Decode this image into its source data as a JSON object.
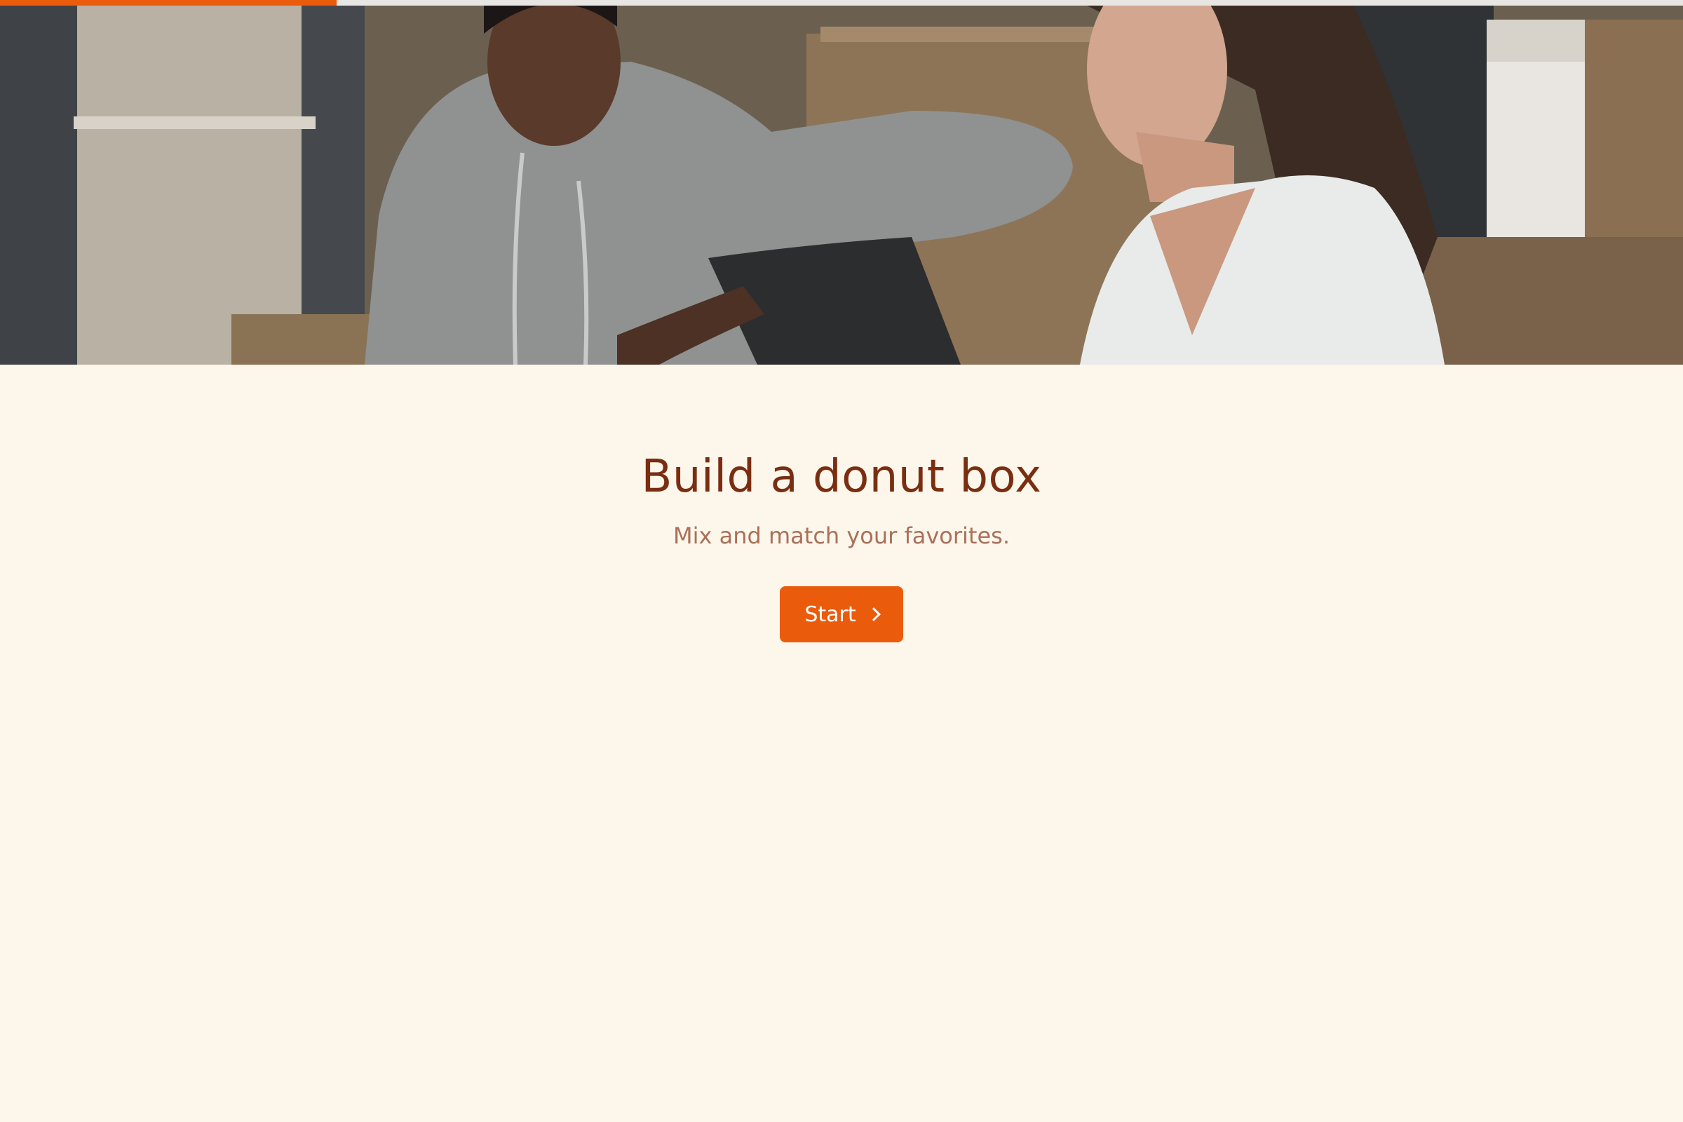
{
  "progress": {
    "fraction": 0.2,
    "fill_color": "#ea5b0c",
    "track_color": "#e8e6e3"
  },
  "hero": {
    "image_icon": "photo-couple-moving-boxes"
  },
  "main": {
    "title": "Build a donut box",
    "subtitle": "Mix and match your favorites.",
    "start_label": "Start",
    "start_icon": "chevron-right-icon"
  },
  "colors": {
    "background": "#fdf6eb",
    "accent": "#ea5b0c",
    "title": "#7a2e11",
    "subtitle": "#a9705a"
  }
}
